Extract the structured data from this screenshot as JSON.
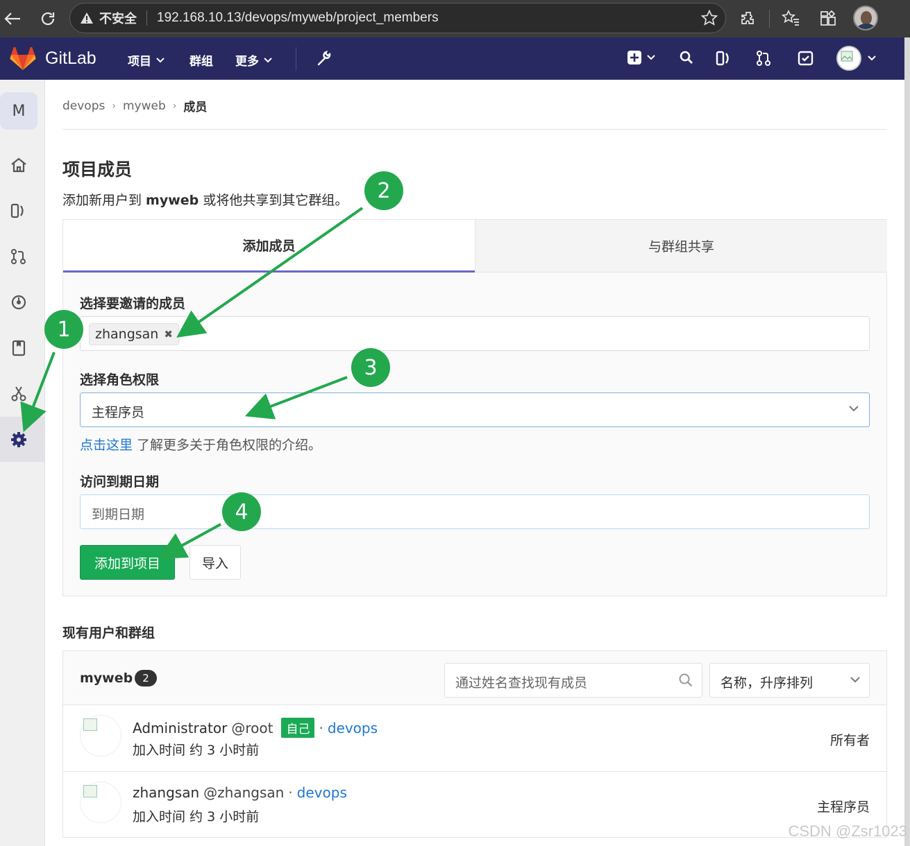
{
  "browser": {
    "security_label": "不安全",
    "url": "192.168.10.13/devops/myweb/project_members"
  },
  "navbar": {
    "brand": "GitLab",
    "items": [
      {
        "label": "项目"
      },
      {
        "label": "群组"
      },
      {
        "label": "更多"
      }
    ]
  },
  "sidebar": {
    "avatar_letter": "M"
  },
  "breadcrumb": [
    "devops",
    "myweb",
    "成员"
  ],
  "page": {
    "title": "项目成员",
    "desc_pre": "添加新用户到 ",
    "desc_project": "myweb",
    "desc_post": " 或将他共享到其它群组。"
  },
  "tabs": [
    "添加成员",
    "与群组共享"
  ],
  "form": {
    "invite_label": "选择要邀请的成员",
    "invite_token": "zhangsan",
    "role_label": "选择角色权限",
    "role_value": "主程序员",
    "help_link": "点击这里",
    "help_text": " 了解更多关于角色权限的介绍。",
    "expiry_label": "访问到期日期",
    "expiry_placeholder": "到期日期",
    "add_button": "添加到项目",
    "import_button": "导入"
  },
  "members": {
    "section_title": "现有用户和群组",
    "project_name": "myweb",
    "count": "2",
    "search_placeholder": "通过姓名查找现有成员",
    "sort_value": "名称，升序排列",
    "rows": [
      {
        "name": "Administrator",
        "username": "@root",
        "self_badge": "自己",
        "group": "devops",
        "joined": "加入时间 约 3 小时前",
        "role": "所有者"
      },
      {
        "name": "zhangsan",
        "username": "@zhangsan",
        "group": "devops",
        "joined": "加入时间 约 3 小时前",
        "role": "主程序员"
      }
    ]
  },
  "annotations": [
    "1",
    "2",
    "3",
    "4"
  ],
  "watermark": "CSDN @Zsr1023",
  "colors": {
    "navbar": "#292961",
    "accent_green": "#1aaa55",
    "tab_underline": "#6b67c7",
    "link": "#1f78d1"
  }
}
